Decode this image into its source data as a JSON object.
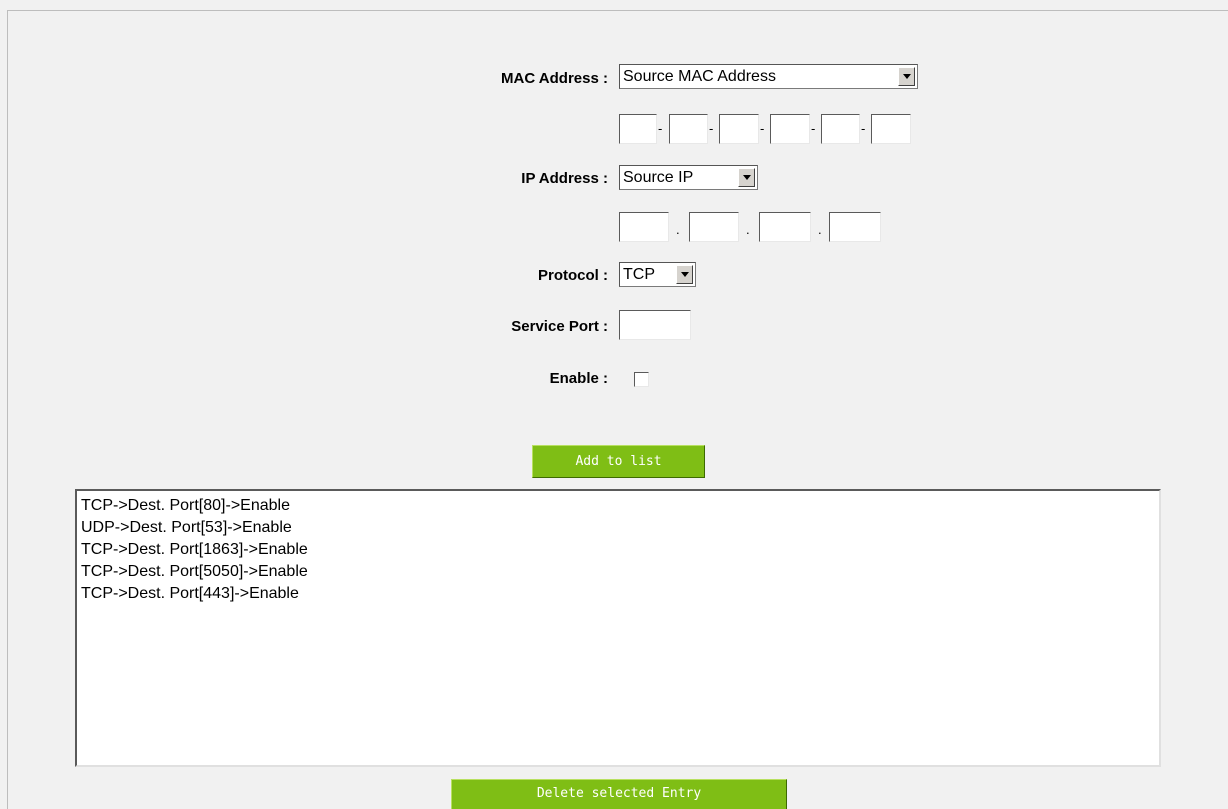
{
  "form": {
    "mac_label": "MAC Address :",
    "mac_select": "Source MAC Address",
    "mac_separator": "-",
    "ip_label": "IP Address :",
    "ip_select": "Source IP",
    "ip_separator": ".",
    "protocol_label": "Protocol :",
    "protocol_select": "TCP",
    "port_label": "Service Port :",
    "enable_label": "Enable :",
    "enable_checked": false
  },
  "buttons": {
    "add": "Add to list",
    "delete": "Delete selected Entry"
  },
  "entries": [
    "TCP->Dest. Port[80]->Enable",
    "UDP->Dest. Port[53]->Enable",
    "TCP->Dest. Port[1863]->Enable",
    "TCP->Dest. Port[5050]->Enable",
    "TCP->Dest. Port[443]->Enable"
  ]
}
